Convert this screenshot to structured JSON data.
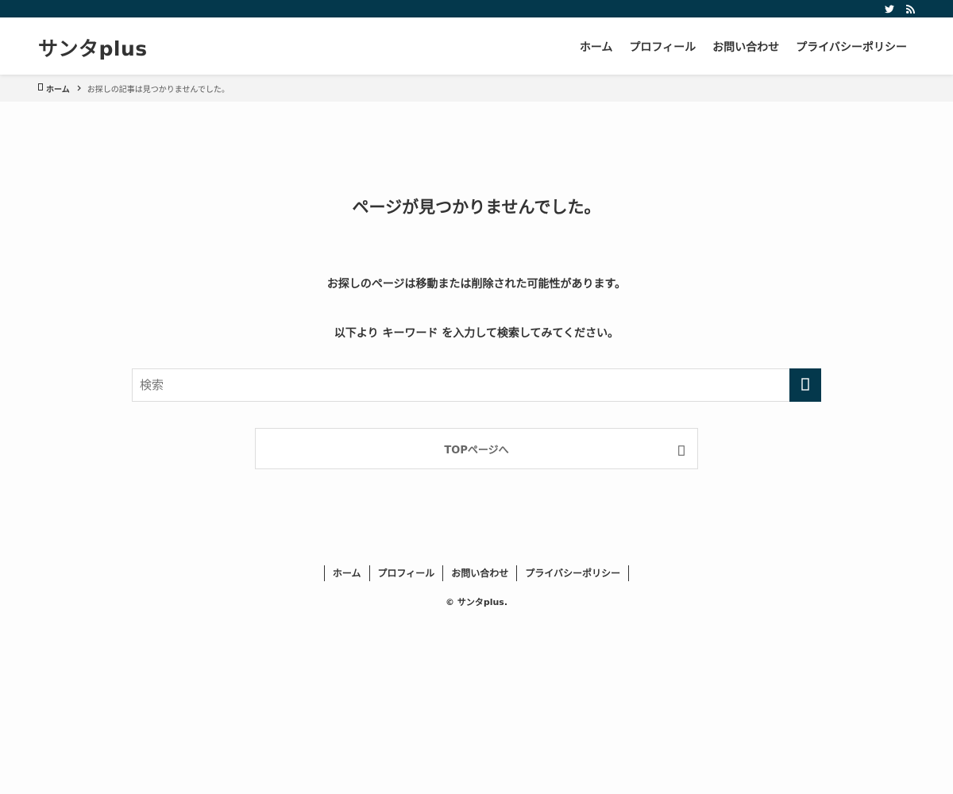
{
  "colors": {
    "brand_dark": "#04384c",
    "text": "#333333",
    "background": "#fdfdfd",
    "breadcrumb_bg": "#f3f3f3",
    "border": "#dddddd"
  },
  "topbar": {
    "icons": [
      "twitter-icon",
      "rss-icon"
    ]
  },
  "header": {
    "site_title": "サンタplus",
    "nav": [
      "ホーム",
      "プロフィール",
      "お問い合わせ",
      "プライバシーポリシー"
    ]
  },
  "breadcrumb": {
    "home_icon": "home-icon",
    "home_label": "ホーム",
    "separator_icon": "chevron-right-icon",
    "current": "お探しの記事は見つかりませんでした。"
  },
  "main": {
    "heading": "ページが見つかりませんでした。",
    "message1": "お探しのページは移動または削除された可能性があります。",
    "message2": "以下より キーワード を入力して検索してみてください。",
    "search": {
      "placeholder": "検索",
      "value": "",
      "button_icon": "search-icon"
    },
    "top_button": {
      "label": "TOPページへ",
      "icon": "chevron-right-icon"
    }
  },
  "footer": {
    "nav": [
      "ホーム",
      "プロフィール",
      "お問い合わせ",
      "プライバシーポリシー"
    ],
    "copyright": "© サンタplus."
  }
}
